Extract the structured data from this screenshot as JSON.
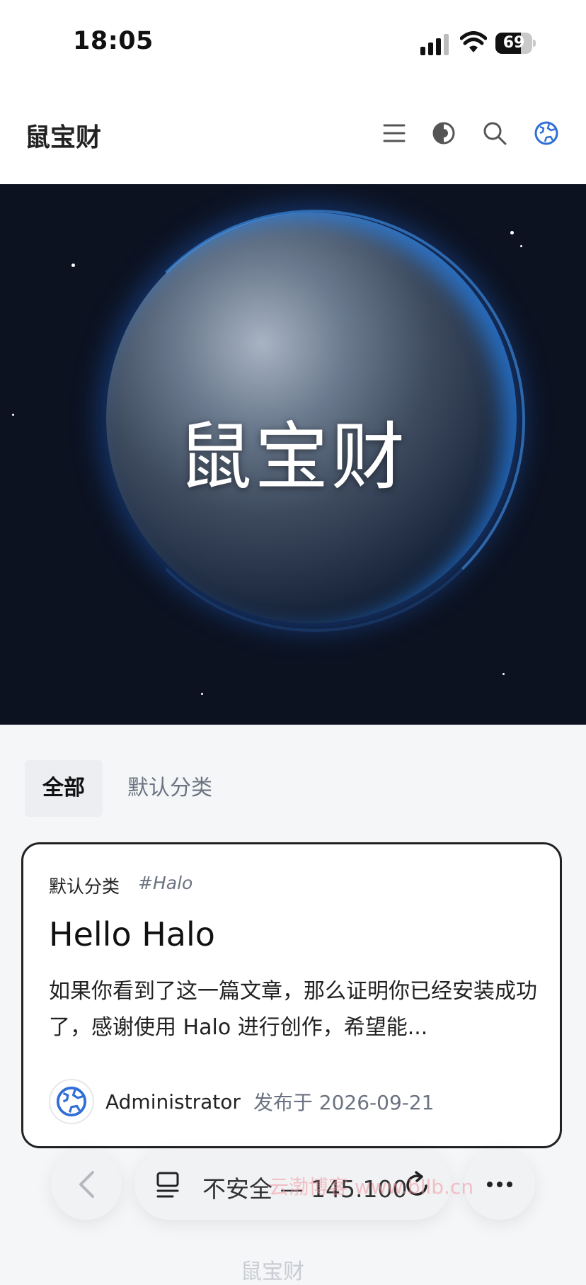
{
  "status_bar": {
    "time": "18:05",
    "battery": "69",
    "battery_level": 0.69
  },
  "header": {
    "title": "鼠宝财",
    "icons": [
      "menu-icon",
      "theme-toggle-icon",
      "search-icon",
      "globe-icon"
    ]
  },
  "hero": {
    "title": "鼠宝财"
  },
  "tabs": [
    {
      "label": "全部",
      "active": true
    },
    {
      "label": "默认分类",
      "active": false
    }
  ],
  "post": {
    "category": "默认分类",
    "tag": "#Halo",
    "title": "Hello Halo",
    "excerpt": "如果你看到了这一篇文章，那么证明你已经安装成功了，感谢使用 Halo 进行创作，希望能...",
    "author": "Administrator",
    "published": "发布于 2026-09-21"
  },
  "browser": {
    "url_text": "不安全 — 145.100",
    "watermark": "云渤博客 www.bllb.cn",
    "below": "鼠宝财"
  },
  "colors": {
    "accent_blue": "#2f6fd6",
    "card_border": "#222222",
    "hero_bg": "#0c1220"
  }
}
